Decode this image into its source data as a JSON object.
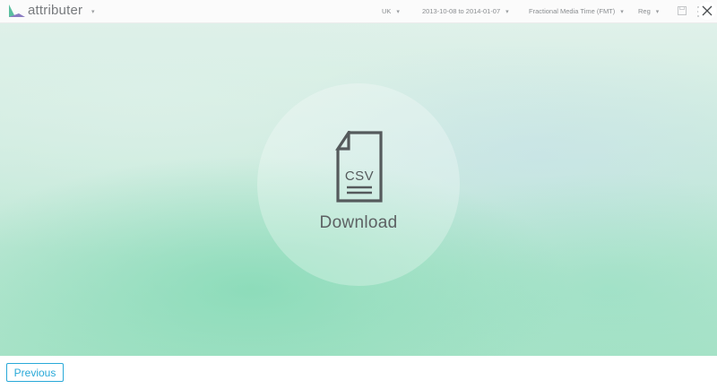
{
  "header": {
    "app_name": "attributer",
    "caret": "▾",
    "filters": [
      {
        "label": "UK"
      },
      {
        "label": "2013-10-08 to 2014-01-07"
      },
      {
        "label": "Fractional Media Time (FMT)"
      },
      {
        "label": "Reg"
      }
    ],
    "icons": [
      "logo-icon",
      "save-icon",
      "more-icon",
      "close-icon"
    ]
  },
  "main": {
    "download": {
      "icon_text": "CSV",
      "label": "Download"
    }
  },
  "footer": {
    "previous_label": "Previous"
  },
  "colors": {
    "accent": "#29a9d8",
    "text_dark": "#5d6163",
    "background_green": "#a9e3c8"
  }
}
